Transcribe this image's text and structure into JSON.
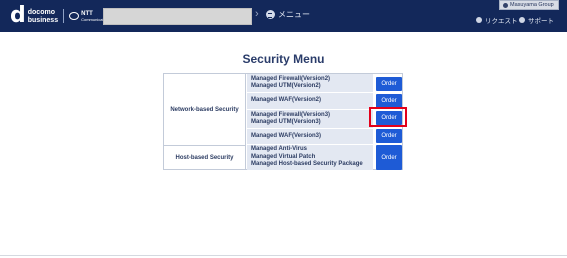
{
  "header": {
    "logo": {
      "top": "docomo",
      "bottom": "business",
      "partner_line1": "NTT",
      "partner_line2": "Communications"
    },
    "menu_label": "メニュー",
    "user_label": "Masuyama Group",
    "request_label": "リクエスト",
    "support_label": "サポート"
  },
  "page": {
    "title": "Security Menu"
  },
  "categories": [
    {
      "label": "Network-based Security"
    },
    {
      "label": "Host-based Security"
    }
  ],
  "services": [
    {
      "lines": [
        "Managed Firewall(Version2)",
        "Managed UTM(Version2)"
      ],
      "order_label": "Order"
    },
    {
      "lines": [
        "Managed WAF(Version2)"
      ],
      "order_label": "Order"
    },
    {
      "lines": [
        "Managed Firewall(Version3)",
        "Managed UTM(Version3)"
      ],
      "order_label": "Order"
    },
    {
      "lines": [
        "Managed WAF(Version3)"
      ],
      "order_label": "Order"
    },
    {
      "lines": [
        "Managed Anti-Virus",
        "Managed Virtual Patch",
        "Managed Host-based Security Package"
      ],
      "order_label": "Order"
    }
  ],
  "colors": {
    "header_bg": "#13285a",
    "order_button": "#1e5bd6",
    "highlight": "#e3001b",
    "service_bg": "#e3e8f2"
  }
}
